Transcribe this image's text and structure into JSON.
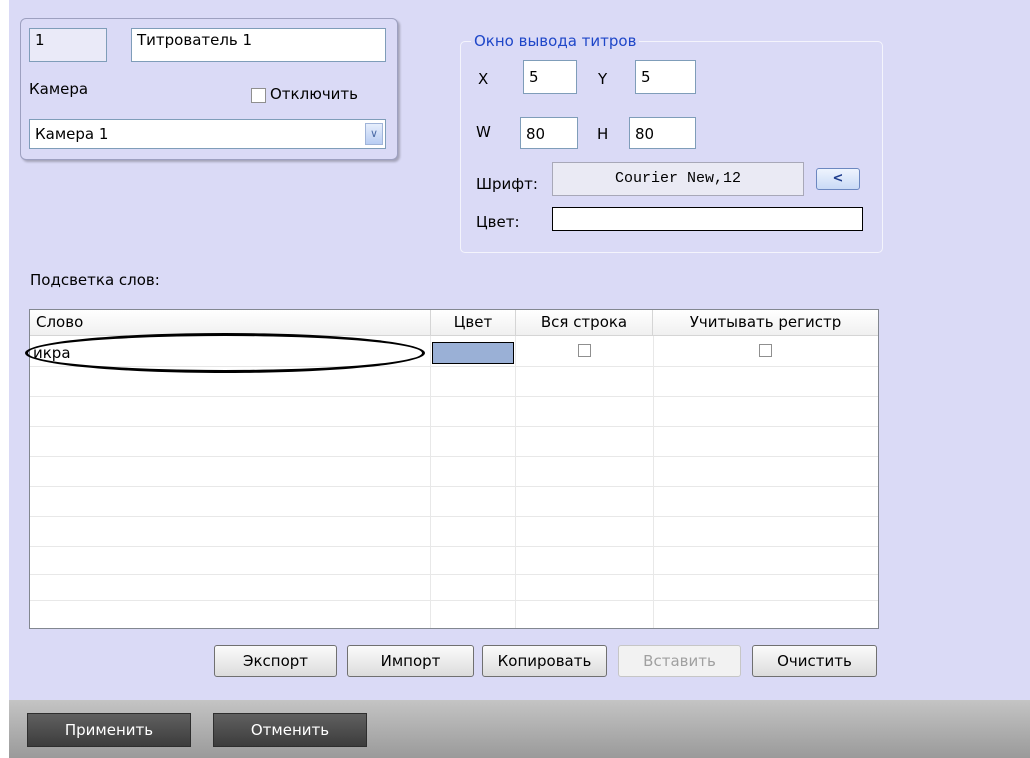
{
  "titler": {
    "id": "1",
    "name": "Титрователь 1",
    "camera_label": "Камера",
    "disable_label": "Отключить",
    "camera_value": "Камера 1",
    "camera_arrow": "∨"
  },
  "output_window": {
    "title": "Окно вывода титров",
    "x_label": "X",
    "x_value": "5",
    "y_label": "Y",
    "y_value": "5",
    "w_label": "W",
    "w_value": "80",
    "h_label": "H",
    "h_value": "80",
    "font_label": "Шрифт:",
    "font_value": "Courier New,12",
    "font_button": "<",
    "color_label": "Цвет:"
  },
  "highlight": {
    "title": "Подсветка слов:",
    "columns": [
      "Слово",
      "Цвет",
      "Вся строка",
      "Учитывать регистр"
    ],
    "rows": [
      {
        "word": "икра",
        "color": "#9ab0d6",
        "whole_line": false,
        "case_sensitive": false
      }
    ]
  },
  "buttons": {
    "export": "Экспорт",
    "import": "Импорт",
    "copy": "Копировать",
    "paste": "Вставить",
    "clear": "Очистить"
  },
  "footer": {
    "apply": "Применить",
    "cancel": "Отменить"
  }
}
